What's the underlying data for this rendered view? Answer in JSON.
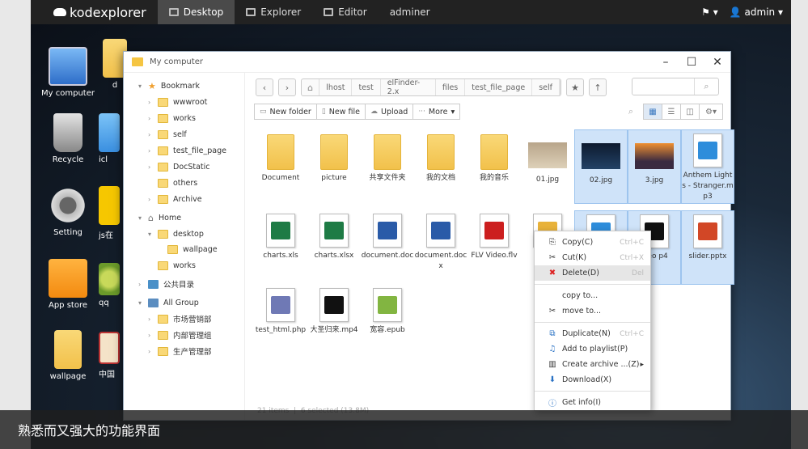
{
  "topbar": {
    "brand": "kodexplorer",
    "tabs": [
      {
        "label": "Desktop",
        "active": true,
        "icon": "desktop-icon"
      },
      {
        "label": "Explorer",
        "active": false,
        "icon": "explorer-icon"
      },
      {
        "label": "Editor",
        "active": false,
        "icon": "editor-icon"
      },
      {
        "label": "adminer",
        "active": false,
        "icon": ""
      }
    ],
    "user": "admin"
  },
  "desktop_icons": [
    {
      "label": "My computer"
    },
    {
      "label": "Recycle"
    },
    {
      "label": "Setting"
    },
    {
      "label": "App store"
    },
    {
      "label": "wallpage"
    },
    {
      "label": "d"
    },
    {
      "label": "icl"
    },
    {
      "label": "js在"
    },
    {
      "label": "qq"
    },
    {
      "label": "中国"
    }
  ],
  "window": {
    "title": "My computer",
    "sidebar": {
      "bookmark": "Bookmark",
      "bookmark_items": [
        "wwwroot",
        "works",
        "self",
        "test_file_page",
        "DocStatic",
        "others",
        "Archive"
      ],
      "home": "Home",
      "desktop": "desktop",
      "wallpage": "wallpage",
      "home_works": "works",
      "public": "公共目录",
      "all_group": "All Group",
      "groups": [
        "市场营销部",
        "内部管理组",
        "生产管理部"
      ]
    },
    "breadcrumb": [
      "lhost",
      "test",
      "elFinder-2.x",
      "files",
      "test_file_page",
      "self"
    ],
    "toolbar": {
      "new_folder": "New folder",
      "new_file": "New file",
      "upload": "Upload",
      "more": "More"
    },
    "files": [
      {
        "name": "Document",
        "kind": "folder",
        "selected": false
      },
      {
        "name": "picture",
        "kind": "folder",
        "selected": false
      },
      {
        "name": "共享文件夹",
        "kind": "folder",
        "selected": false
      },
      {
        "name": "我的文档",
        "kind": "folder",
        "selected": false
      },
      {
        "name": "我的音乐",
        "kind": "folder",
        "selected": false
      },
      {
        "name": "01.jpg",
        "kind": "photo",
        "selected": false
      },
      {
        "name": "02.jpg",
        "kind": "photo",
        "selected": true
      },
      {
        "name": "3.jpg",
        "kind": "photo",
        "selected": true
      },
      {
        "name": "Anthem Lights - Stranger.mp3",
        "kind": "music",
        "selected": true
      },
      {
        "name": "charts.xls",
        "kind": "excel",
        "selected": false
      },
      {
        "name": "charts.xlsx",
        "kind": "excel",
        "selected": false
      },
      {
        "name": "document.doc",
        "kind": "word",
        "selected": false
      },
      {
        "name": "document.docx",
        "kind": "word",
        "selected": false
      },
      {
        "name": "FLV Video.flv",
        "kind": "flv",
        "selected": false
      },
      {
        "name": "fo",
        "kind": "zip",
        "selected": false
      },
      {
        "name": "",
        "kind": "music",
        "selected": true
      },
      {
        "name": "ideo\np4",
        "kind": "video",
        "selected": true
      },
      {
        "name": "slider.pptx",
        "kind": "ppt",
        "selected": true
      },
      {
        "name": "test_html.php",
        "kind": "php",
        "selected": false
      },
      {
        "name": "大圣归来.mp4",
        "kind": "video",
        "selected": false
      },
      {
        "name": "宽容.epub",
        "kind": "epub",
        "selected": false
      }
    ],
    "status": {
      "count": "21 items",
      "selected": "6 selected (13.8M)"
    }
  },
  "context_menu": [
    {
      "label": "Copy",
      "key": "C",
      "shortcut": "Ctrl+C",
      "icon": "copy-icon"
    },
    {
      "label": "Cut",
      "key": "K",
      "shortcut": "Ctrl+X",
      "icon": "cut-icon"
    },
    {
      "label": "Delete",
      "key": "D",
      "shortcut": "Del",
      "icon": "delete-icon",
      "highlighted": true
    },
    {
      "sep": true
    },
    {
      "label": "copy to...",
      "key": "",
      "shortcut": "",
      "icon": "copy-to-icon"
    },
    {
      "label": "move to...",
      "key": "",
      "shortcut": "",
      "icon": "move-to-icon"
    },
    {
      "sep": true
    },
    {
      "label": "Duplicate",
      "key": "N",
      "shortcut": "Ctrl+C",
      "icon": "duplicate-icon"
    },
    {
      "label": "Add to playlist",
      "key": "P",
      "shortcut": "",
      "icon": "playlist-icon"
    },
    {
      "label": "Create archive ...",
      "key": "Z",
      "shortcut": "",
      "icon": "archive-icon",
      "submenu": true
    },
    {
      "label": "Download",
      "key": "X",
      "shortcut": "",
      "icon": "download-icon"
    },
    {
      "sep": true
    },
    {
      "label": "Get info",
      "key": "I",
      "shortcut": "",
      "icon": "info-icon"
    }
  ],
  "caption": "熟悉而又强大的功能界面"
}
